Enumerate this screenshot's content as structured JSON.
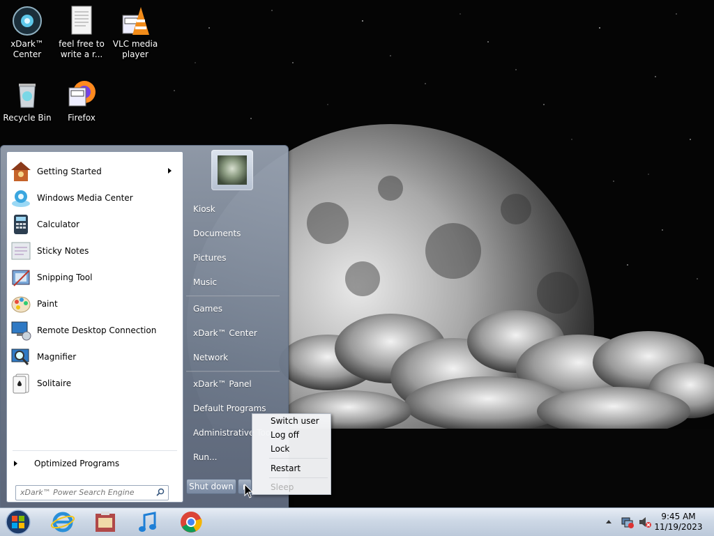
{
  "desktop": {
    "icons": [
      {
        "label_line1": "xDark™",
        "label_line2": "Center",
        "icon": "xdark-center-icon"
      },
      {
        "label_line1": "feel free to",
        "label_line2": "write a r...",
        "icon": "text-document-icon"
      },
      {
        "label_line1": "VLC media",
        "label_line2": "player",
        "icon": "vlc-icon"
      },
      {
        "label_line1": "Recycle Bin",
        "label_line2": "",
        "icon": "recycle-bin-icon"
      },
      {
        "label_line1": "Firefox",
        "label_line2": "",
        "icon": "firefox-icon"
      }
    ]
  },
  "start_menu": {
    "programs": [
      {
        "label": "Getting Started",
        "icon": "getting-started-icon",
        "has_submenu": true
      },
      {
        "label": "Windows Media Center",
        "icon": "media-center-icon"
      },
      {
        "label": "Calculator",
        "icon": "calculator-icon"
      },
      {
        "label": "Sticky Notes",
        "icon": "sticky-notes-icon"
      },
      {
        "label": "Snipping Tool",
        "icon": "snipping-tool-icon"
      },
      {
        "label": "Paint",
        "icon": "paint-icon"
      },
      {
        "label": "Remote Desktop Connection",
        "icon": "remote-desktop-icon"
      },
      {
        "label": "Magnifier",
        "icon": "magnifier-icon"
      },
      {
        "label": "Solitaire",
        "icon": "solitaire-icon"
      }
    ],
    "all_programs_label": "Optimized Programs",
    "search_placeholder": "xDark™ Power Search Engine",
    "right_links": [
      "Kiosk",
      "Documents",
      "Pictures",
      "Music",
      "Games",
      "xDark™ Center",
      "Network",
      "xDark™ Panel",
      "Default Programs",
      "Administrative Tools",
      "Run..."
    ],
    "shutdown_label": "Shut down"
  },
  "power_menu": {
    "items": [
      "Switch user",
      "Log off",
      "Lock",
      "Restart",
      "Sleep"
    ],
    "disabled": [
      "Sleep"
    ]
  },
  "taskbar": {
    "pinned": [
      "internet-explorer-icon",
      "media-app-icon",
      "music-note-icon",
      "chrome-icon"
    ],
    "tray_icons": [
      "show-hidden-icons-icon",
      "network-icon",
      "volume-muted-icon"
    ],
    "clock_time": "9:45 AM",
    "clock_date": "11/19/2023"
  }
}
